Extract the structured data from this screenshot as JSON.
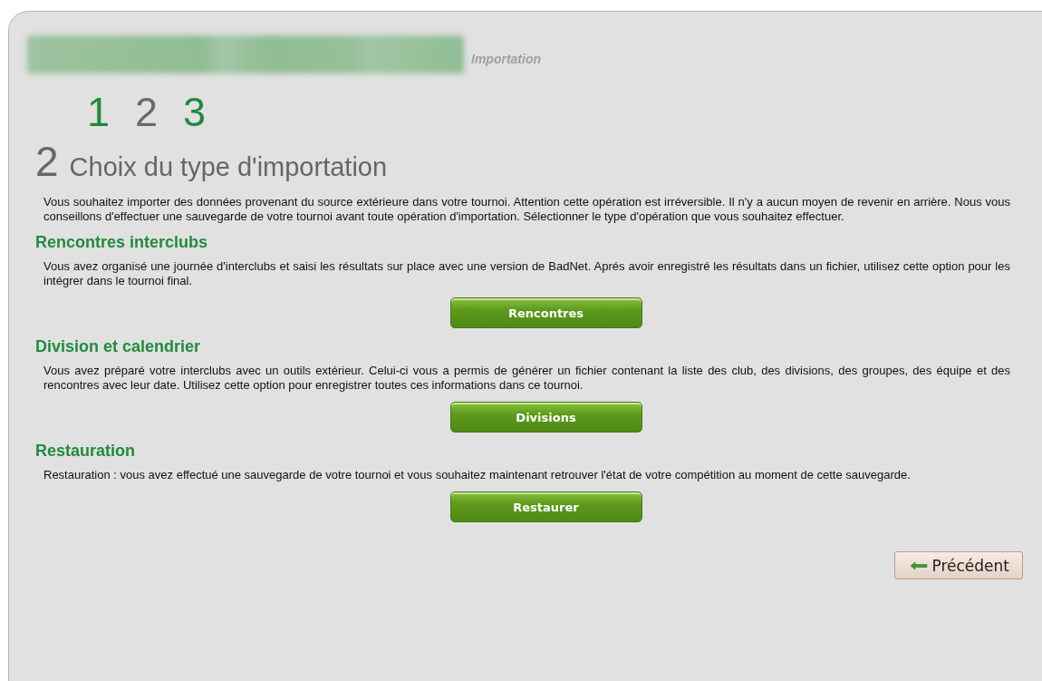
{
  "header": {
    "subtitle": "Importation"
  },
  "steps": [
    {
      "label": "1",
      "selected": false
    },
    {
      "label": "2",
      "selected": true
    },
    {
      "label": "3",
      "selected": false
    }
  ],
  "heading": {
    "number": "2",
    "title": "Choix du type d'importation"
  },
  "intro": "Vous souhaitez importer des données provenant du source extérieure dans votre tournoi. Attention cette opération est irréversible. Il n'y a aucun moyen de revenir en arrière. Nous vous conseillons d'effectuer une sauvegarde de votre tournoi avant toute opération d'importation. Sélectionner le type d'opération que vous souhaitez effectuer.",
  "sections": [
    {
      "title": "Rencontres interclubs",
      "text": "Vous avez organisé une journée d'interclubs et saisi les résultats sur place avec une version de BadNet. Aprés avoir enregistré les résultats dans un fichier, utilisez cette option pour les intégrer dans le tournoi final.",
      "button": "Rencontres"
    },
    {
      "title": "Division et calendrier",
      "text": "Vous avez préparé votre interclubs avec un outils extérieur. Celui-ci vous a permis de générer un fichier contenant la liste des club, des divisions, des groupes, des équipe et des rencontres avec leur date. Utilisez cette option pour enregistrer toutes ces informations dans ce tournoi.",
      "button": "Divisions"
    },
    {
      "title": "Restauration",
      "text": "Restauration : vous avez effectué une sauvegarde de votre tournoi et vous souhaitez maintenant retrouver l'état de votre compétition au moment de cette sauvegarde.",
      "button": "Restaurer"
    }
  ],
  "back_button": "Précédent"
}
